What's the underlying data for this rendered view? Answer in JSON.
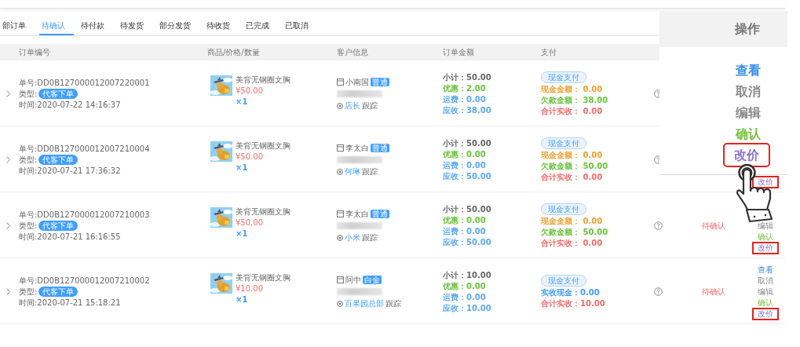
{
  "tabs": [
    {
      "label": "部订单",
      "selected": false
    },
    {
      "label": "待确认",
      "selected": true
    },
    {
      "label": "待付款",
      "selected": false
    },
    {
      "label": "待发货",
      "selected": false
    },
    {
      "label": "部分发货",
      "selected": false
    },
    {
      "label": "待收货",
      "selected": false
    },
    {
      "label": "已完成",
      "selected": false
    },
    {
      "label": "已取消",
      "selected": false
    }
  ],
  "table": {
    "columns": [
      "订单编号",
      "商品/价格/数量",
      "客户信息",
      "订单金额",
      "支付"
    ],
    "rows": [
      {
        "order_no": "单号:DD0B127000012007220001",
        "type_label": "类型:",
        "type_tag": "代客下单",
        "time": "时间:2020-07-22 14:16:37",
        "product": {
          "name": "美背无钢圈文胸",
          "price": "¥50.00",
          "qty": "×1"
        },
        "customer": {
          "name": "小南国",
          "tag": "普通",
          "follower": "店长",
          "follow_suffix": "跟踪"
        },
        "amounts": [
          {
            "kind": "subtotal",
            "text": "小计：50.00"
          },
          {
            "kind": "discount",
            "text": "优惠：2.00"
          },
          {
            "kind": "shipping",
            "text": "运费：0.00"
          },
          {
            "kind": "receivable",
            "text": "应收：38.00"
          }
        ],
        "payment": {
          "method": "现金支付",
          "lines": [
            {
              "kind": "cash",
              "text": "现金金额： 0.00"
            },
            {
              "kind": "debt",
              "text": "欠款金额： 38.00"
            },
            {
              "kind": "total",
              "text": "合计实收： 0.00"
            }
          ]
        },
        "actions": []
      },
      {
        "order_no": "单号:DD0B127000012007210004",
        "type_label": "类型:",
        "type_tag": "代客下单",
        "time": "时间:2020-07-21 17:36:32",
        "product": {
          "name": "美背无钢圈文胸",
          "price": "¥50.00",
          "qty": "×1"
        },
        "customer": {
          "name": "李太白",
          "tag": "普通",
          "follower": "何琳",
          "follow_suffix": "跟踪"
        },
        "amounts": [
          {
            "kind": "subtotal",
            "text": "小计：50.00"
          },
          {
            "kind": "discount",
            "text": "优惠：0.00"
          },
          {
            "kind": "shipping",
            "text": "运费：0.00"
          },
          {
            "kind": "receivable",
            "text": "应收：50.00"
          }
        ],
        "payment": {
          "method": "现金支付",
          "lines": [
            {
              "kind": "cash",
              "text": "现金金额： 0.00"
            },
            {
              "kind": "debt",
              "text": "欠款金额： 50.00"
            },
            {
              "kind": "total",
              "text": "合计实收： 0.00"
            }
          ]
        },
        "actions": [
          {
            "label": "改价",
            "kind": "price",
            "highlighted": true
          }
        ]
      },
      {
        "order_no": "单号:DD0B127000012007210003",
        "type_label": "类型:",
        "type_tag": "代客下单",
        "time": "时间:2020-07-21 16:16:55",
        "product": {
          "name": "美背无钢圈文胸",
          "price": "¥50.00",
          "qty": "×1"
        },
        "customer": {
          "name": "李太白",
          "tag": "普通",
          "follower": "小米",
          "follow_suffix": "跟踪"
        },
        "amounts": [
          {
            "kind": "subtotal",
            "text": "小计：50.00"
          },
          {
            "kind": "discount",
            "text": "优惠：0.00"
          },
          {
            "kind": "shipping",
            "text": "运费：0.00"
          },
          {
            "kind": "receivable",
            "text": "应收：50.00"
          }
        ],
        "payment": {
          "method": "现金支付",
          "lines": [
            {
              "kind": "cash",
              "text": "现金金额： 0.00"
            },
            {
              "kind": "debt",
              "text": "欠款金额： 50.00"
            },
            {
              "kind": "total",
              "text": "合计实收： 0.00"
            }
          ]
        },
        "status": "待确认",
        "actions": [
          {
            "label": "编辑",
            "kind": "edit",
            "highlighted": false
          },
          {
            "label": "确认",
            "kind": "confirm",
            "highlighted": false
          },
          {
            "label": "改价",
            "kind": "price",
            "highlighted": true
          }
        ]
      },
      {
        "order_no": "单号:DD0B127000012007210002",
        "type_label": "类型:",
        "type_tag": "代客下单",
        "time": "时间:2020-07-21 15:18:21",
        "product": {
          "name": "美背无钢圈文胸",
          "price": "¥10.00",
          "qty": "×1"
        },
        "customer": {
          "name": "阿中",
          "tag": "白金",
          "follower": "百果园总部",
          "follow_suffix": "跟踪"
        },
        "amounts": [
          {
            "kind": "subtotal",
            "text": "小计：10.00"
          },
          {
            "kind": "discount",
            "text": "优惠：0.00"
          },
          {
            "kind": "shipping",
            "text": "运费：0.00"
          },
          {
            "kind": "receivable",
            "text": "应收：10.00"
          }
        ],
        "payment": {
          "method": "现金支付",
          "lines": [
            {
              "kind": "received",
              "text": "实收现金：0.00"
            },
            {
              "kind": "total",
              "text": "合计实收：10.00"
            }
          ]
        },
        "status": "待确认",
        "actions": [
          {
            "label": "查看",
            "kind": "view",
            "highlighted": false
          },
          {
            "label": "取消",
            "kind": "cancel",
            "highlighted": false
          },
          {
            "label": "编辑",
            "kind": "edit",
            "highlighted": false
          },
          {
            "label": "确认",
            "kind": "confirm",
            "highlighted": false
          },
          {
            "label": "改价",
            "kind": "price",
            "highlighted": true
          }
        ]
      }
    ]
  },
  "zoom_callout": {
    "title": "操作",
    "actions": [
      {
        "label": "查看",
        "kind": "view",
        "highlighted": false
      },
      {
        "label": "取消",
        "kind": "cancel",
        "highlighted": false
      },
      {
        "label": "编辑",
        "kind": "edit",
        "highlighted": false
      },
      {
        "label": "确认",
        "kind": "confirm",
        "highlighted": false
      },
      {
        "label": "改价",
        "kind": "price",
        "highlighted": true
      }
    ]
  }
}
